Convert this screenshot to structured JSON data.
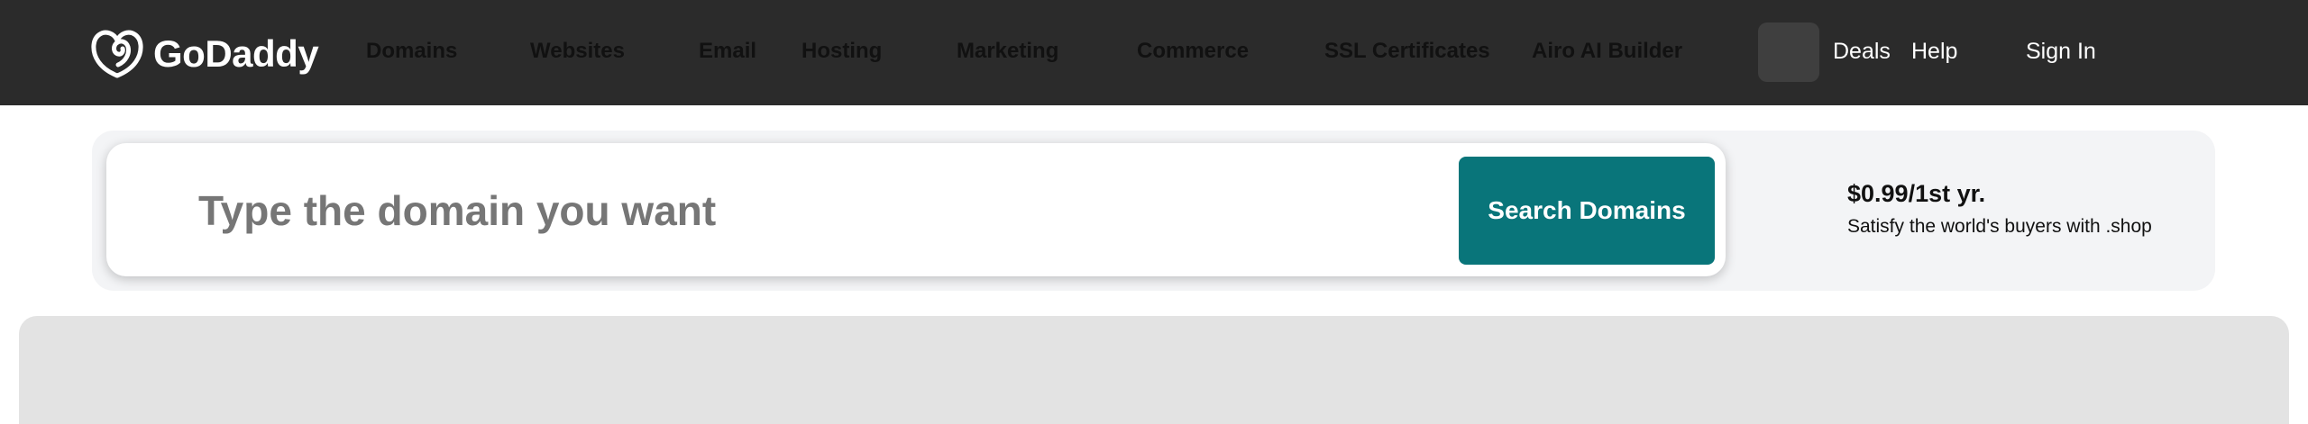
{
  "brand": {
    "name": "GoDaddy",
    "logo_icon": "godaddy-heart-icon"
  },
  "nav": {
    "items": [
      {
        "label": "Domains"
      },
      {
        "label": "Websites"
      },
      {
        "label": "Email"
      },
      {
        "label": "Hosting"
      },
      {
        "label": "Marketing"
      },
      {
        "label": "Commerce"
      },
      {
        "label": "SSL Certificates"
      },
      {
        "label": "Airo AI Builder"
      }
    ]
  },
  "header_right": {
    "deals_label": "Deals",
    "help_label": "Help",
    "signin_label": "Sign In"
  },
  "search": {
    "placeholder": "Type the domain you want",
    "button_label": "Search Domains"
  },
  "promo": {
    "price": "$0.99/1st yr.",
    "text": "Satisfy the world's buyers with .shop"
  },
  "colors": {
    "header_bg": "#2b2b2b",
    "accent_button": "#09757a",
    "band_bg": "#f3f4f6",
    "hero_bg": "#e3e3e3"
  }
}
